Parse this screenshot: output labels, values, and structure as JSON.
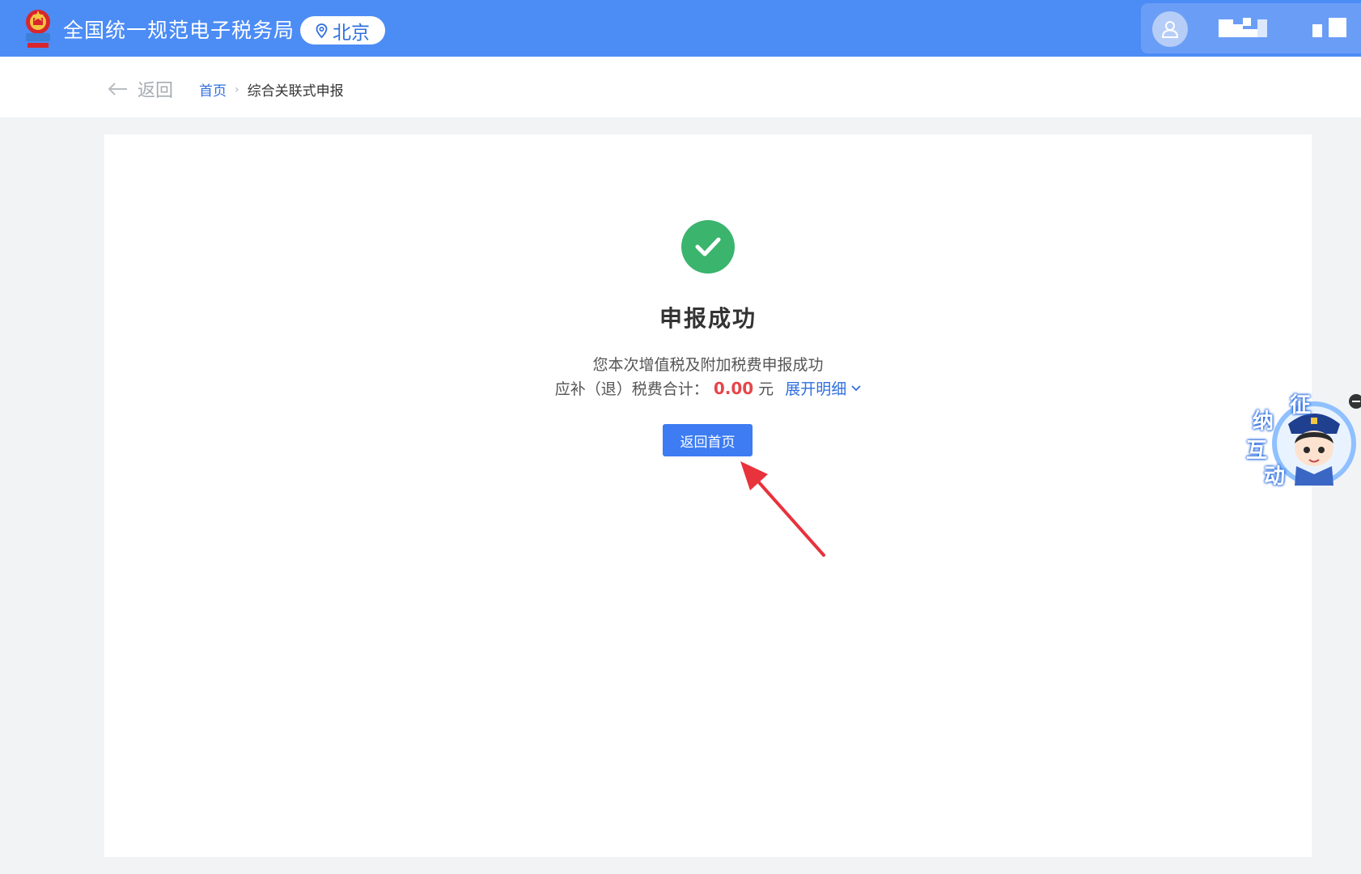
{
  "header": {
    "site_title": "全国统一规范电子税务局",
    "location": "北京",
    "emblem_icon": "national-emblem-icon",
    "user_icon": "user-avatar-icon"
  },
  "breadcrumb": {
    "back_label": "返回",
    "home_label": "首页",
    "separator": "›",
    "current_label": "综合关联式申报"
  },
  "result": {
    "status_icon": "check-circle-icon",
    "title": "申报成功",
    "description": "您本次增值税及附加税费申报成功",
    "tax_total_label": "应补（退）税费合计：",
    "tax_total_amount": "0.00",
    "tax_total_unit": "元",
    "expand_label": "展开明细",
    "home_button_label": "返回首页"
  },
  "assistant": {
    "chars": [
      "征",
      "纳",
      "互",
      "动"
    ]
  },
  "colors": {
    "header_bg": "#4c8cf5",
    "primary": "#3d7cf2",
    "success": "#3bb46e",
    "amount": "#e6454a",
    "annotation_arrow": "#e8323c"
  }
}
